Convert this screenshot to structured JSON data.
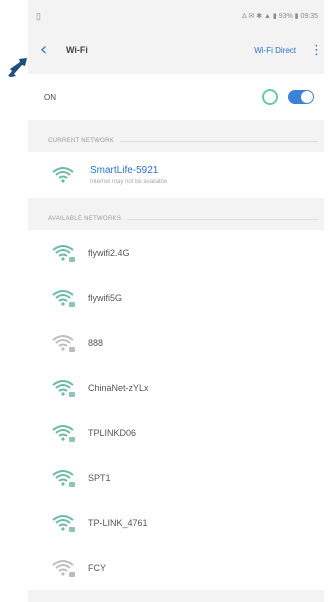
{
  "statusbar": {
    "left_icon": "sim-icon",
    "right_text": "∆ ✉ ✱ ▲ ▮ 93% ▮ 09:35"
  },
  "appbar": {
    "back_icon": "back-arrow-icon",
    "title": "Wi-Fi",
    "action": "Wi-Fi Direct",
    "more_icon": "more-vert-icon"
  },
  "wifi_toggle": {
    "label": "ON",
    "state": "on"
  },
  "current_network": {
    "header": "CURRENT NETWORK",
    "ssid": "SmartLife-5921",
    "status": "Internet may not be available"
  },
  "available": {
    "header": "AVAILABLE NETWORKS",
    "networks": [
      {
        "ssid": "flywifi2.4G",
        "secured": true,
        "strength": "strong"
      },
      {
        "ssid": "flywifi5G",
        "secured": true,
        "strength": "strong"
      },
      {
        "ssid": "888",
        "secured": true,
        "strength": "weak"
      },
      {
        "ssid": "ChinaNet-zYLx",
        "secured": true,
        "strength": "strong"
      },
      {
        "ssid": "TPLINKD06",
        "secured": true,
        "strength": "strong"
      },
      {
        "ssid": "SPT1",
        "secured": true,
        "strength": "strong"
      },
      {
        "ssid": "TP-LINK_4761",
        "secured": true,
        "strength": "strong"
      },
      {
        "ssid": "FCY",
        "secured": true,
        "strength": "weak"
      }
    ]
  },
  "colors": {
    "accent": "#2a72c9",
    "wifi_icon": "#6bb9a8",
    "wifi_icon_weak": "#bdbdbd"
  }
}
